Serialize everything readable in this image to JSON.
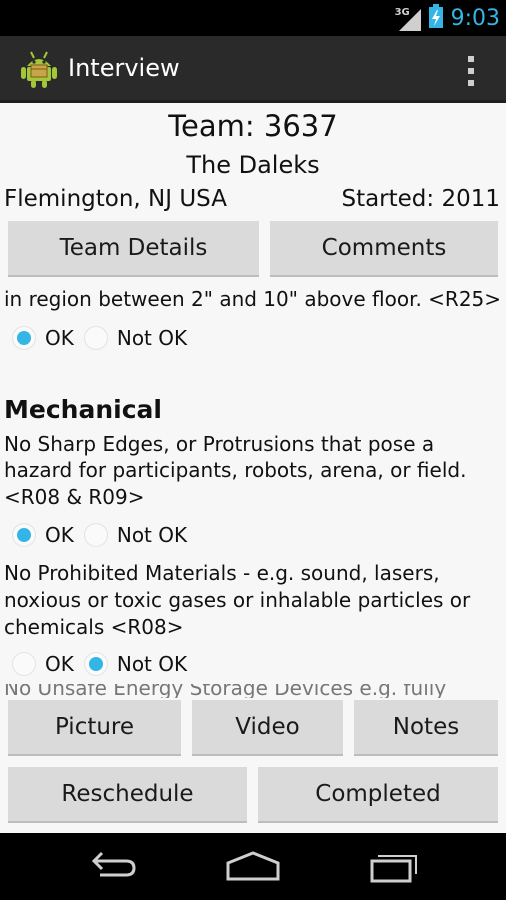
{
  "status_bar": {
    "network": "3G",
    "time": "9:03",
    "icons": [
      "signal-icon",
      "battery-charging-icon"
    ]
  },
  "action_bar": {
    "title": "Interview",
    "icons": [
      "android-app-icon",
      "overflow-menu-icon"
    ]
  },
  "team": {
    "number_label": "Team: 3637",
    "name": "The Daleks",
    "location": "Flemington, NJ USA",
    "started": "Started: 2011"
  },
  "top_buttons": {
    "team_details": "Team Details",
    "comments": "Comments"
  },
  "checklist": {
    "partial_item_text": "in region between 2\" and 10\" above floor. <R25>",
    "partial_item_selected": "ok",
    "option_ok": "OK",
    "option_not_ok": "Not OK",
    "section_title": "Mechanical",
    "items": [
      {
        "lines": [
          "No Sharp Edges, or Protrusions that pose a",
          "hazard for participants, robots, arena, or field.",
          "<R08 & R09>"
        ],
        "selected": "ok"
      },
      {
        "lines": [
          "No Prohibited Materials - e.g. sound, lasers,",
          "noxious or toxic gases or inhalable particles or",
          "chemicals <R08>"
        ],
        "selected": "not_ok"
      }
    ],
    "next_item_partial": "No Unsafe Energy Storage Devices e.g. fully"
  },
  "bottom_buttons": {
    "picture": "Picture",
    "video": "Video",
    "notes": "Notes",
    "reschedule": "Reschedule",
    "completed": "Completed"
  },
  "nav_bar": {
    "icons": [
      "back-icon",
      "home-icon",
      "recent-apps-icon"
    ]
  }
}
